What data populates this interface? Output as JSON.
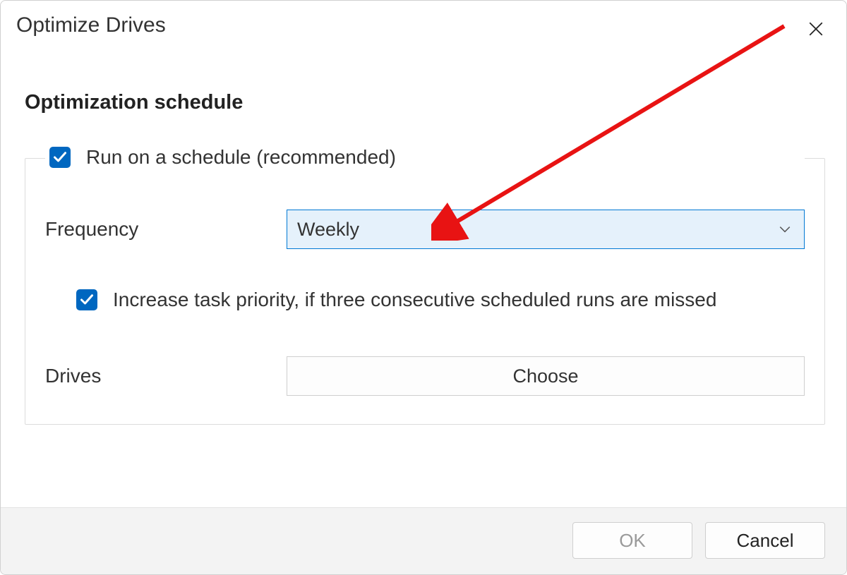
{
  "window": {
    "title": "Optimize Drives"
  },
  "section": {
    "heading": "Optimization schedule"
  },
  "schedule": {
    "run_on_schedule": {
      "checked": true,
      "label": "Run on a schedule (recommended)"
    },
    "frequency": {
      "label": "Frequency",
      "value": "Weekly"
    },
    "increase_priority": {
      "checked": true,
      "label": "Increase task priority, if three consecutive scheduled runs are missed"
    },
    "drives": {
      "label": "Drives",
      "button": "Choose"
    }
  },
  "footer": {
    "ok": "OK",
    "cancel": "Cancel"
  },
  "annotation": {
    "type": "arrow",
    "color": "#e81313",
    "target": "frequency-dropdown"
  }
}
